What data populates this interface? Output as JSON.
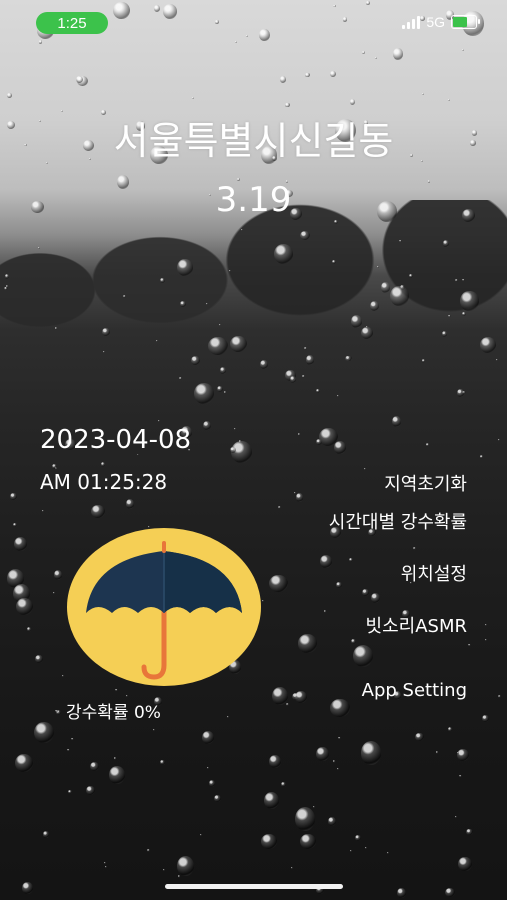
{
  "status_bar": {
    "time": "1:25",
    "network": "5G"
  },
  "header": {
    "location": "서울특별시신길동",
    "temperature": "3.19"
  },
  "datetime": {
    "date": "2023-04-08",
    "time": "AM 01:25:28"
  },
  "menu": {
    "items": [
      {
        "label": "지역초기화"
      },
      {
        "label": "시간대별 강수확률"
      },
      {
        "label": "위치설정"
      },
      {
        "label": "빗소리ASMR"
      },
      {
        "label": "App Setting"
      }
    ]
  },
  "precipitation": {
    "label": "강수확률 0%"
  },
  "colors": {
    "status_green": "#3cc24b",
    "badge_yellow": "#f5cf55",
    "umbrella_dark": "#1d3550",
    "umbrella_light": "#2d4d6b",
    "handle_orange": "#e8763a"
  },
  "icons": {
    "umbrella": "umbrella-icon"
  }
}
